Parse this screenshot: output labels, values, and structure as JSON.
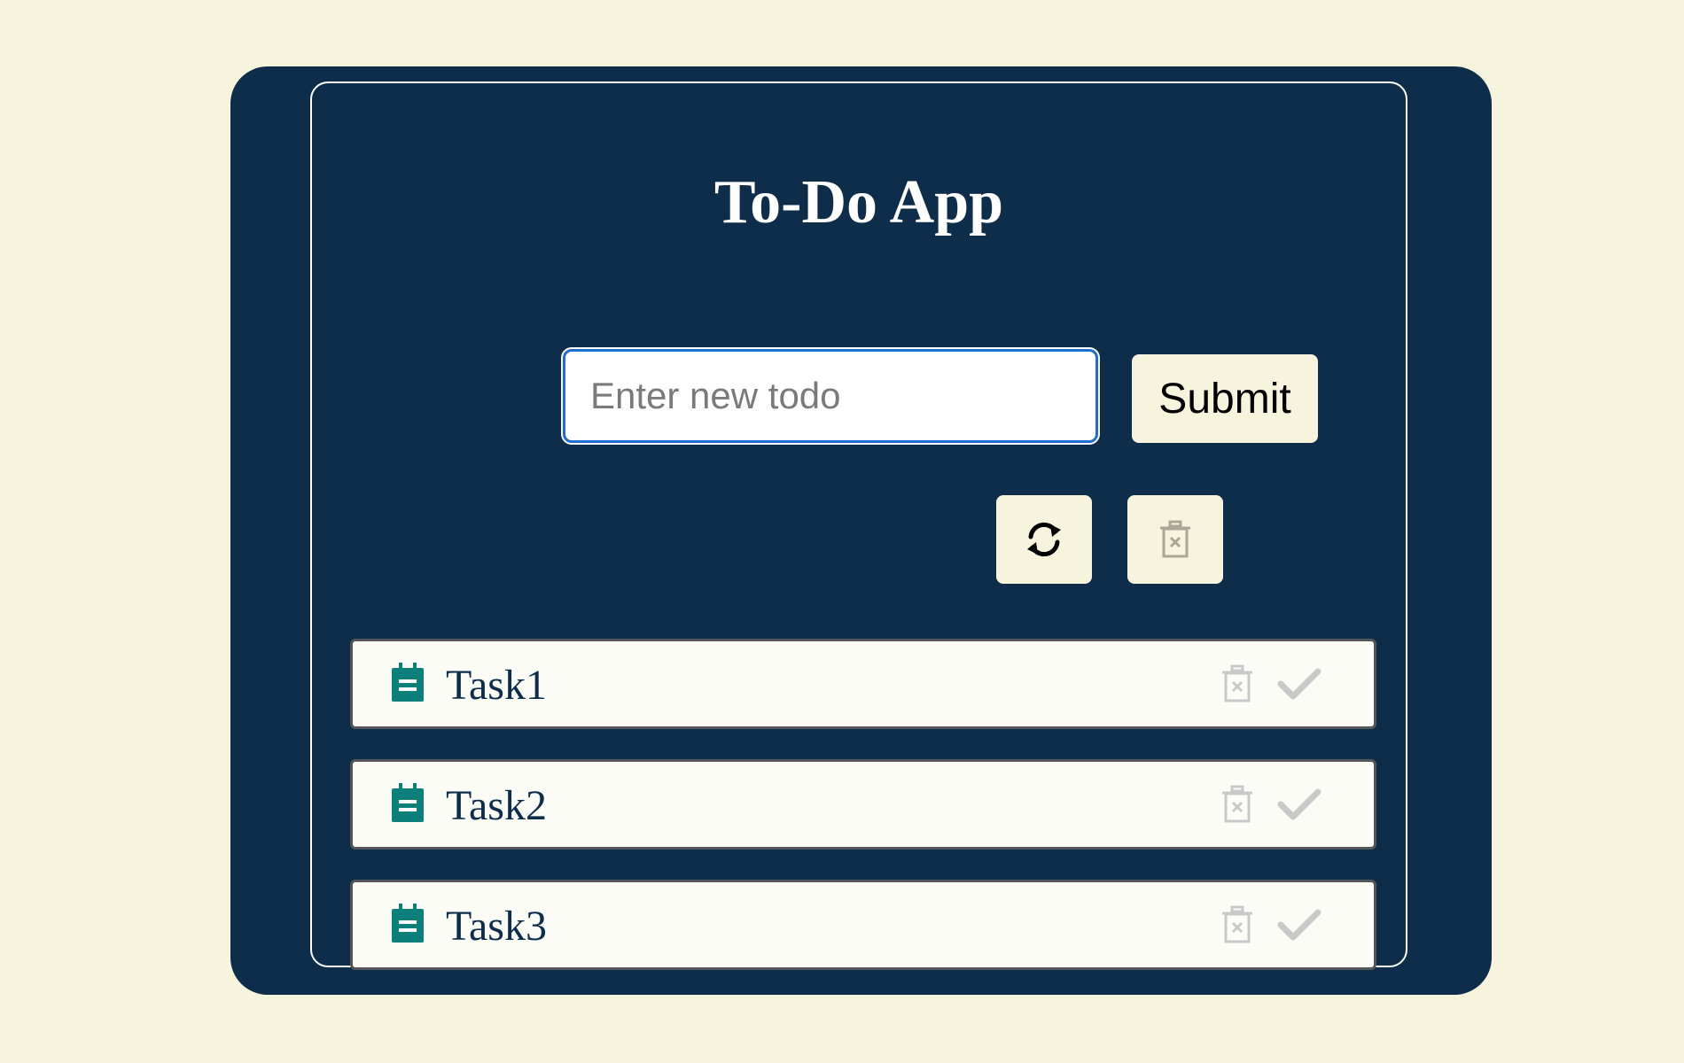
{
  "app": {
    "title": "To-Do App"
  },
  "form": {
    "input_placeholder": "Enter new todo",
    "input_value": "",
    "submit_label": "Submit"
  },
  "toolbar": {
    "refresh_icon": "refresh-icon",
    "clear_icon": "trash-icon"
  },
  "todos": [
    {
      "label": "Task1",
      "icon": "note-icon"
    },
    {
      "label": "Task2",
      "icon": "note-icon"
    },
    {
      "label": "Task3",
      "icon": "note-icon"
    }
  ],
  "colors": {
    "page_background": "#f6f4dd",
    "card_background": "#0d2d4a",
    "accent": "#0b7f79",
    "input_focus_border": "#1f6fd0",
    "item_background": "#fbfcf6",
    "muted_icon": "#c9c9c9"
  }
}
